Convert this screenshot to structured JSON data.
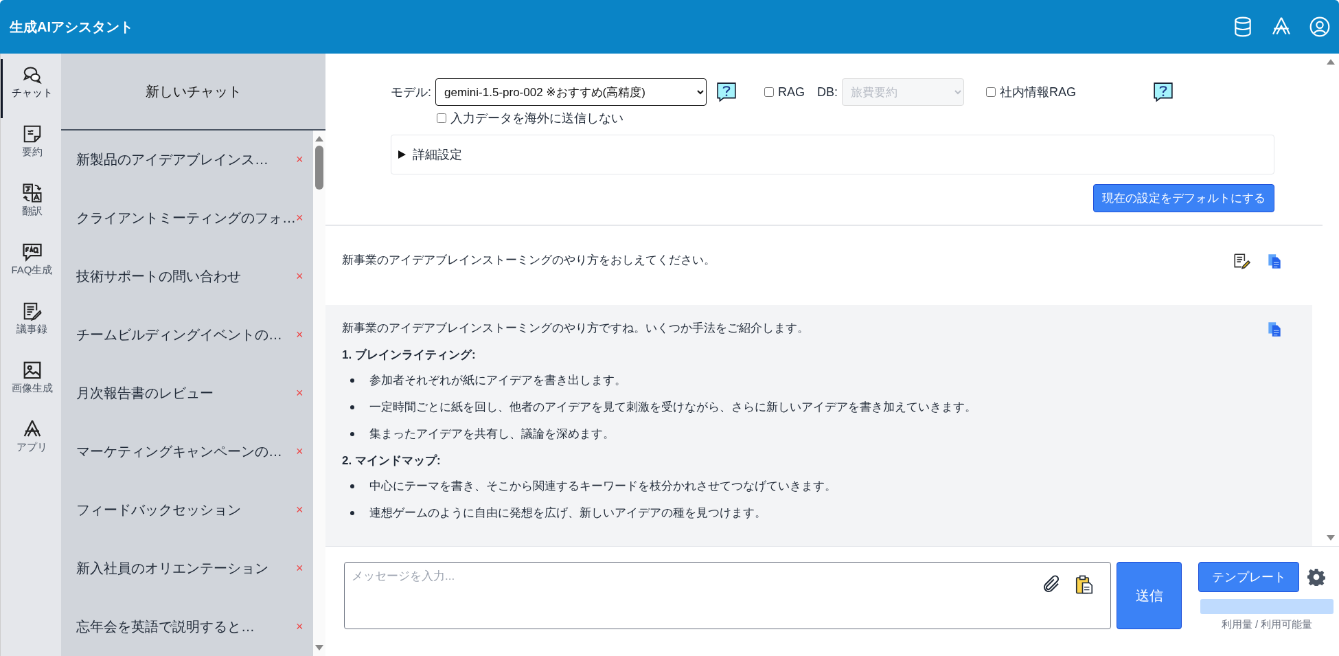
{
  "header": {
    "title": "生成AIアシスタント"
  },
  "nav": [
    {
      "label": "チャット",
      "kind": "chat",
      "selected": true
    },
    {
      "label": "要約",
      "kind": "summary",
      "selected": false
    },
    {
      "label": "翻訳",
      "kind": "translate",
      "selected": false
    },
    {
      "label": "FAQ生成",
      "kind": "faq",
      "selected": false
    },
    {
      "label": "議事録",
      "kind": "minutes",
      "selected": false
    },
    {
      "label": "画像生成",
      "kind": "image",
      "selected": false
    },
    {
      "label": "アプリ",
      "kind": "app",
      "selected": false
    }
  ],
  "chat_list": {
    "new_chat": "新しいチャット",
    "items": [
      {
        "title": "新製品のアイデアブレインス…",
        "delete": "×"
      },
      {
        "title": "クライアントミーティングのフォ…",
        "delete": "×"
      },
      {
        "title": "技術サポートの問い合わせ",
        "delete": "×"
      },
      {
        "title": "チームビルディングイベントの…",
        "delete": "×"
      },
      {
        "title": "月次報告書のレビュー",
        "delete": "×"
      },
      {
        "title": "マーケティングキャンペーンの…",
        "delete": "×"
      },
      {
        "title": "フィードバックセッション",
        "delete": "×"
      },
      {
        "title": "新入社員のオリエンテーション",
        "delete": "×"
      },
      {
        "title": "忘年会を英語で説明すると…",
        "delete": "×"
      }
    ]
  },
  "settings": {
    "model_label": "モデル:",
    "model_value": "gemini-1.5-pro-002 ※おすすめ(高精度)",
    "rag": {
      "label": "RAG",
      "checked": false
    },
    "db_label": "DB:",
    "db_value": "旅費要約",
    "db_disabled": true,
    "internal_rag": {
      "label": "社内情報RAG",
      "checked": false
    },
    "no_overseas": {
      "label": "入力データを海外に送信しない",
      "checked": false
    },
    "advanced": {
      "label": "詳細設定",
      "expanded": false
    },
    "default_button": "現在の設定をデフォルトにする"
  },
  "messages": [
    {
      "kind": "user",
      "text": "新事業のアイデアブレインストーミングのやり方をおしえてください。"
    },
    {
      "kind": "assistant",
      "intro": "新事業のアイデアブレインストーミングのやり方ですね。いくつか手法をご紹介します。",
      "sections": [
        {
          "heading": "1. ブレインライティング:",
          "bullets": [
            "参加者それぞれが紙にアイデアを書き出します。",
            "一定時間ごとに紙を回し、他者のアイデアを見て刺激を受けながら、さらに新しいアイデアを書き加えていきます。",
            "集まったアイデアを共有し、議論を深めます。"
          ]
        },
        {
          "heading": "2. マインドマップ:",
          "bullets": [
            "中心にテーマを書き、そこから関連するキーワードを枝分かれさせてつなげていきます。",
            "連想ゲームのように自由に発想を広げ、新しいアイデアの種を見つけます。"
          ]
        }
      ]
    }
  ],
  "input": {
    "placeholder": "メッセージを入力...",
    "send": "送信",
    "template": "テンプレート",
    "usage": {
      "label": "利用量 / 利用可能量"
    }
  }
}
